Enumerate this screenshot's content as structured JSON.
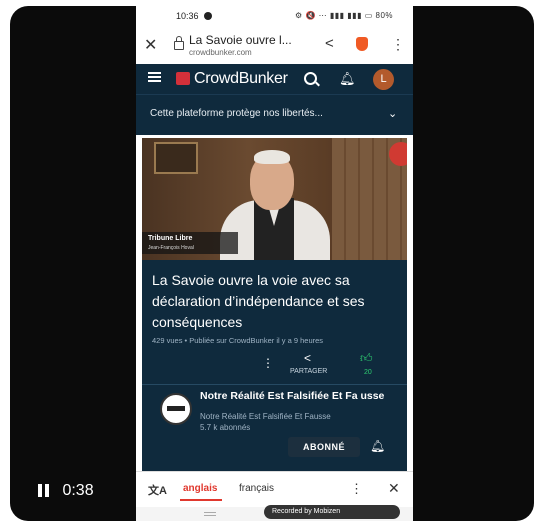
{
  "status_bar": {
    "time": "10:36",
    "right": "⚙ 🔇 ⋯ ▮▮▮ ▮▮▮ ▭ 80%"
  },
  "browser": {
    "close_icon": "✕",
    "page_title": "La Savoie ouvre l...",
    "domain": "crowdbunker.com",
    "share_icon": "share-icon",
    "menu_icon": "⋮"
  },
  "site": {
    "brand": "CrowdBunker",
    "avatar_letter": "L",
    "banner": "Cette plateforme protège nos libertés...",
    "colors": {
      "nav_bg": "#0f2a3d",
      "brand_red": "#d3303a",
      "accent_green": "#2ecc71"
    }
  },
  "video": {
    "lower_third_title": "Tribune Libre",
    "lower_third_name": "Jean-François Hoval"
  },
  "details": {
    "title": "La Savoie ouvre la voie avec sa déclaration d’indépendance et ses conséquences",
    "meta": "429 vues • Publiée sur CrowdBunker il y a 9 heures",
    "share_label": "PARTAGER",
    "likes": "20",
    "channel_name": "Notre Réalité Est Falsifiée Et Fa usse",
    "channel_sub": "Notre Réalité Est Falsifiée Et Fausse",
    "subscribers": "5.7 k abonnés",
    "subscribe_label": "ABONNÉ"
  },
  "translate_bar": {
    "tab_active": "anglais",
    "tab_other": "français"
  },
  "recorder": {
    "label": "Recorded by Mobizen"
  },
  "player": {
    "elapsed": "0:38"
  }
}
